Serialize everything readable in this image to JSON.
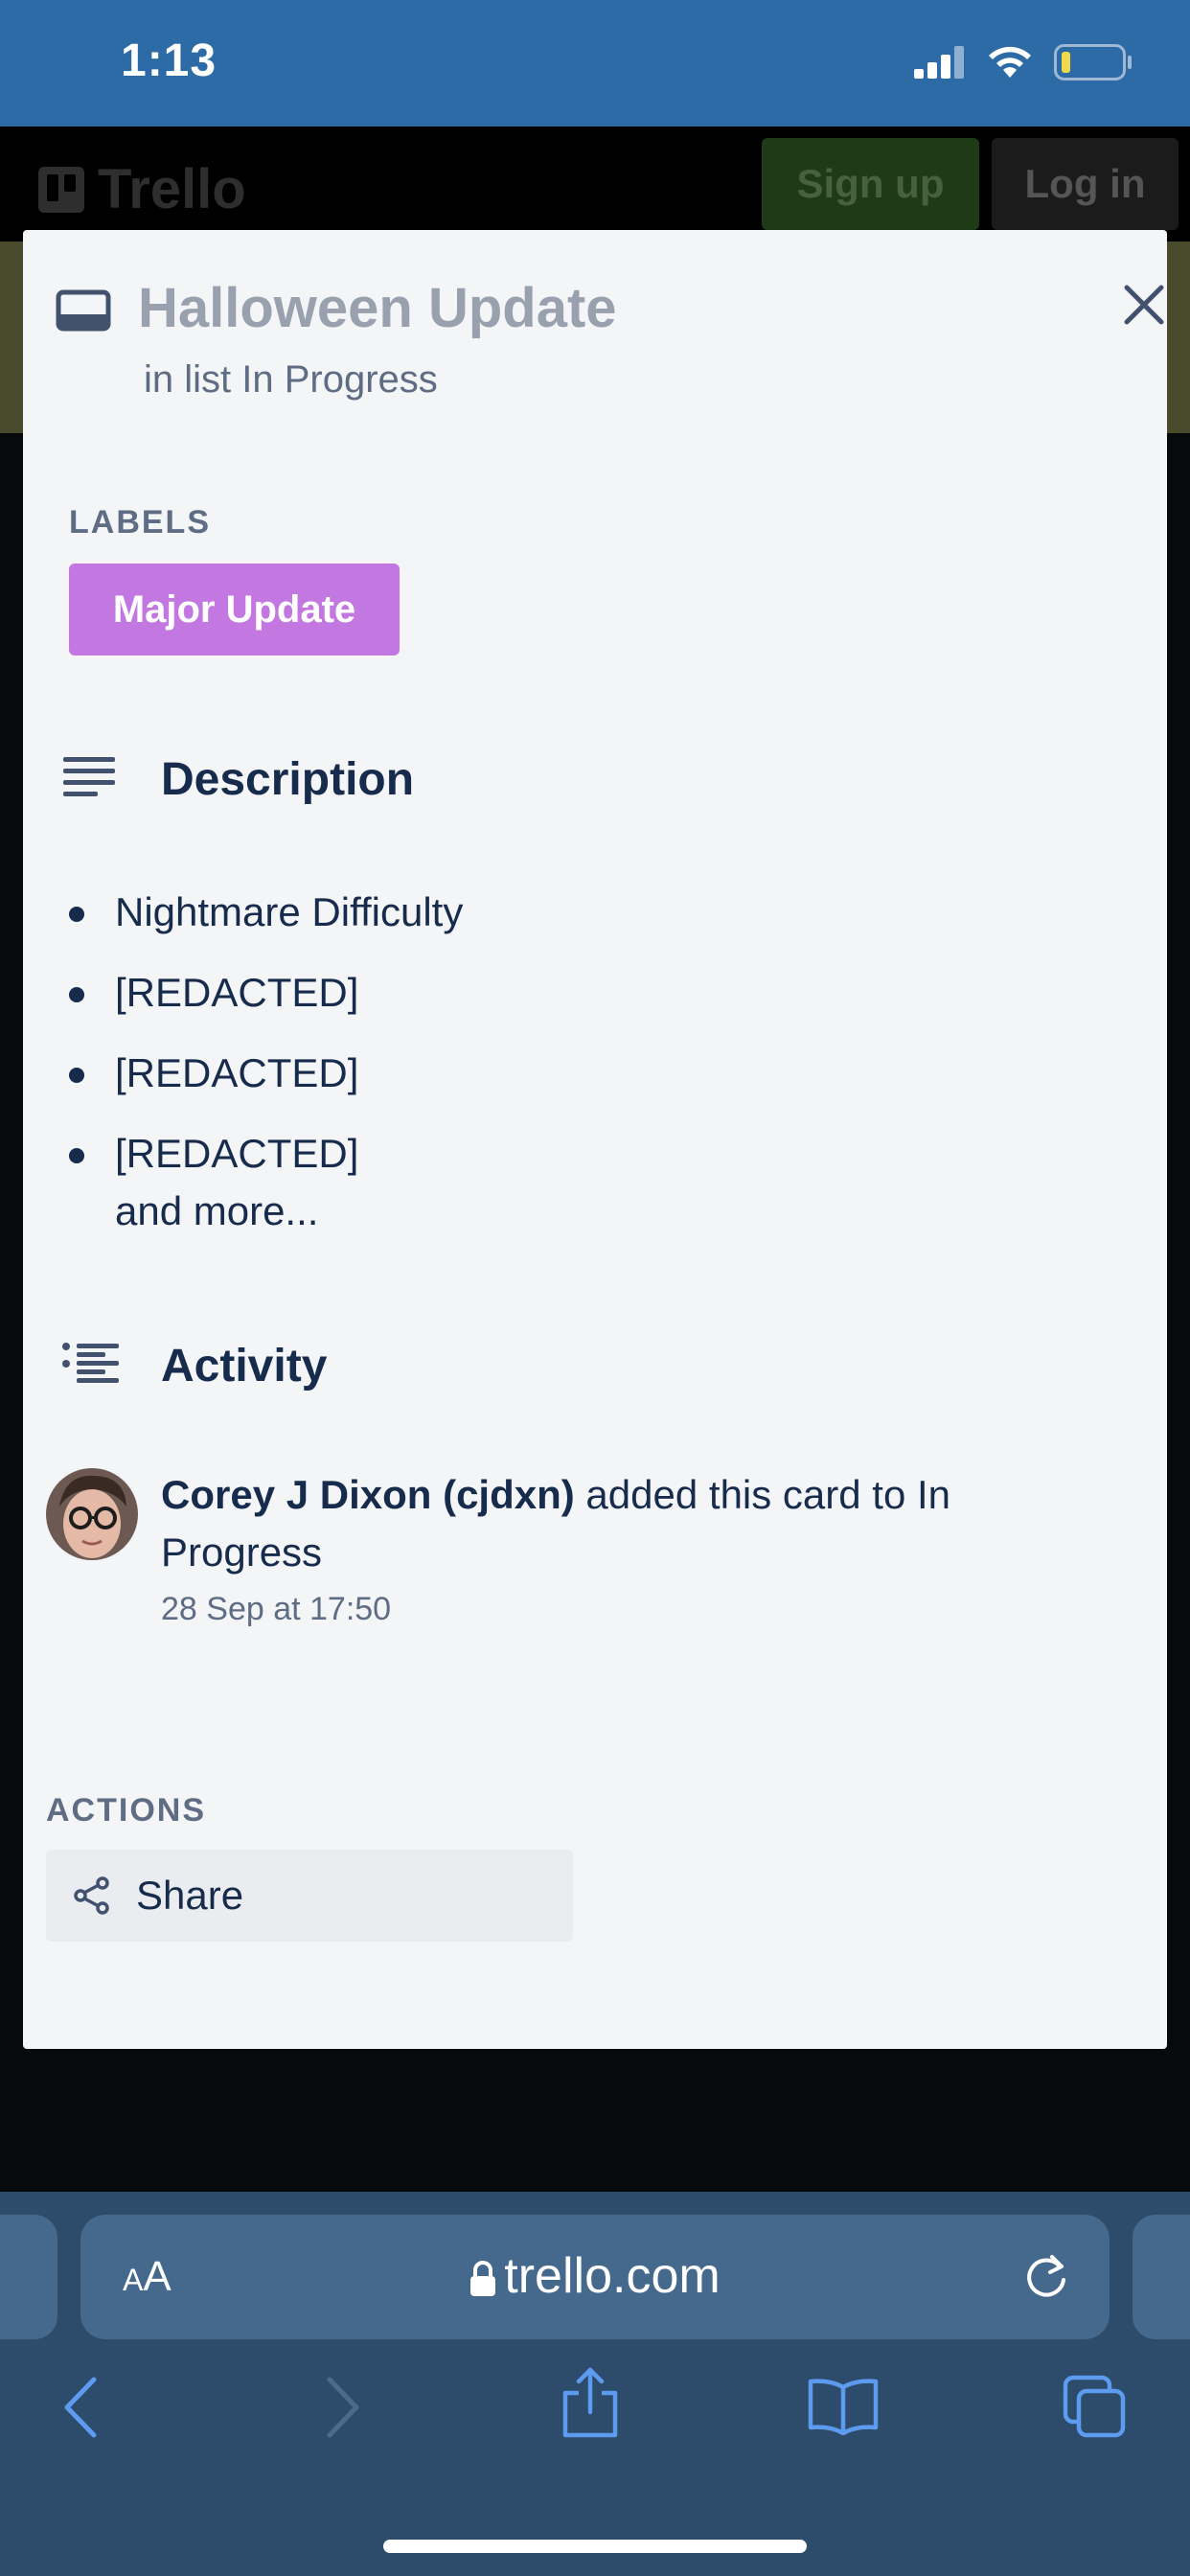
{
  "status_bar": {
    "time": "1:13"
  },
  "header": {
    "logo": "Trello",
    "signup_label": "Sign up",
    "login_label": "Log in"
  },
  "card": {
    "title": "Halloween Update",
    "in_list": "in list In Progress",
    "labels_caption": "LABELS",
    "label": "Major Update",
    "label_color": "#c377e0",
    "description_title": "Description",
    "description_items": [
      "Nightmare Difficulty",
      "[REDACTED]",
      "[REDACTED]",
      "[REDACTED]"
    ],
    "description_more": "and more...",
    "activity_title": "Activity",
    "activity": {
      "user": "Corey J Dixon (cjdxn)",
      "text": " added this card to In Progress",
      "time": "28 Sep at 17:50"
    },
    "actions_caption": "ACTIONS",
    "share_label": "Share"
  },
  "browser": {
    "url": "trello.com",
    "aa": "AA"
  },
  "icons": {
    "card": "card-icon",
    "close": "close-icon",
    "description": "description-icon",
    "activity": "activity-list-icon",
    "share": "share-icon",
    "lock": "lock-icon",
    "reload": "reload-icon",
    "back": "back-icon",
    "forward": "forward-icon",
    "share_sheet": "share-sheet-icon",
    "bookmarks": "bookmarks-icon",
    "tabs": "tabs-icon"
  }
}
